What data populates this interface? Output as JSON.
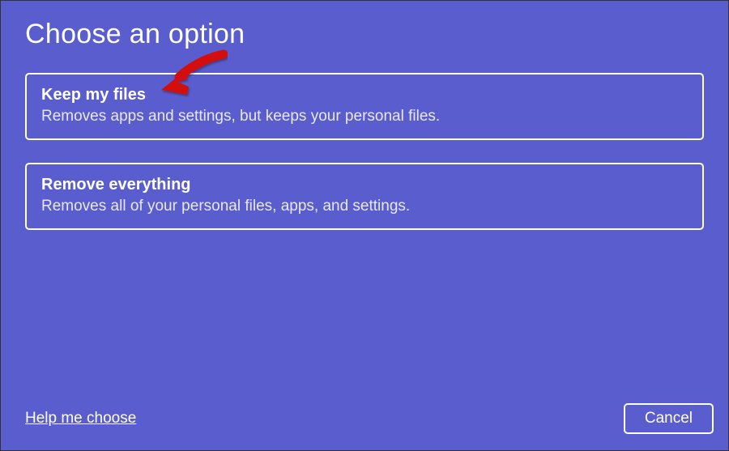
{
  "title": "Choose an option",
  "options": [
    {
      "title": "Keep my files",
      "description": "Removes apps and settings, but keeps your personal files."
    },
    {
      "title": "Remove everything",
      "description": "Removes all of your personal files, apps, and settings."
    }
  ],
  "footer": {
    "help_link": "Help me choose",
    "cancel_label": "Cancel"
  },
  "annotation": {
    "type": "arrow",
    "color": "#d40f0f",
    "target": "option-keep-my-files"
  }
}
